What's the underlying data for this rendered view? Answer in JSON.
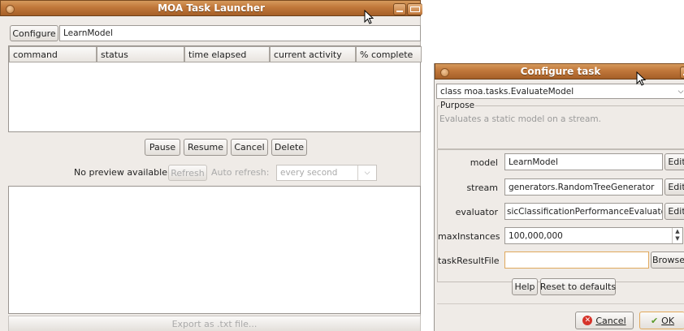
{
  "launcher": {
    "title": "MOA Task Launcher",
    "configure_button": "Configure",
    "task_field_value": "LearnModel",
    "table": {
      "columns": [
        "command",
        "status",
        "time elapsed",
        "current activity",
        "% complete"
      ]
    },
    "buttons": {
      "pause": "Pause",
      "resume": "Resume",
      "cancel": "Cancel",
      "delete": "Delete"
    },
    "preview": {
      "no_preview_text": "No preview available",
      "refresh_button": "Refresh",
      "auto_refresh_label": "Auto refresh:",
      "auto_refresh_value": "every second"
    },
    "export_button": "Export as .txt file..."
  },
  "dialog": {
    "title": "Configure task",
    "class_select_value": "class moa.tasks.EvaluateModel",
    "purpose_legend": "Purpose",
    "purpose_text": "Evaluates a static model on a stream.",
    "params": [
      {
        "label": "model",
        "value": "LearnModel",
        "action": "Edit"
      },
      {
        "label": "stream",
        "value": "generators.RandomTreeGenerator",
        "action": "Edit"
      },
      {
        "label": "evaluator",
        "value": "sicClassificationPerformanceEvaluator",
        "action": "Edit"
      },
      {
        "label": "maxInstances",
        "value": "100,000,000"
      },
      {
        "label": "taskResultFile",
        "value": "",
        "action": "Browse"
      }
    ],
    "help_button": "Help",
    "reset_button": "Reset to defaults",
    "cancel_button": "Cancel",
    "ok_button": "OK"
  },
  "colors": {
    "titlebar": "#c0773a",
    "window_bg": "#efebe7",
    "focus_border": "#e0a85c"
  }
}
